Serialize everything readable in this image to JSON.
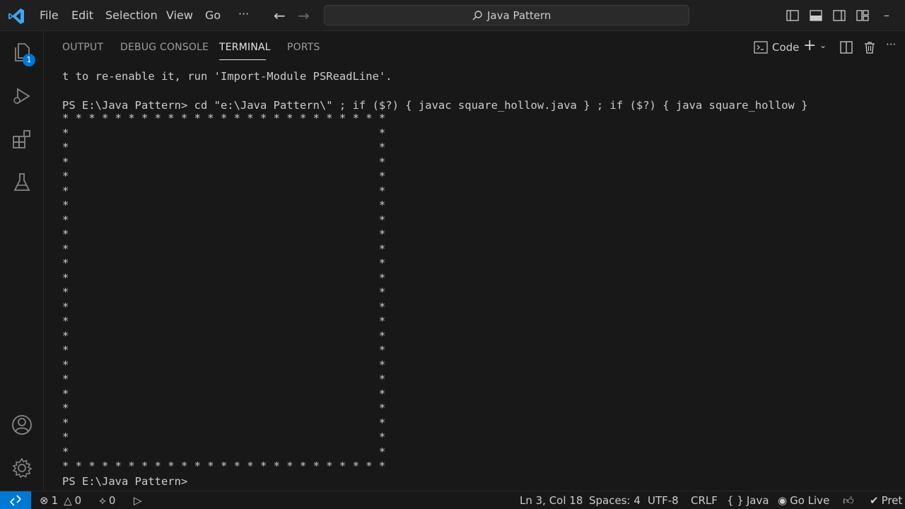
{
  "menu": [
    "File",
    "Edit",
    "Selection",
    "View",
    "Go",
    "···"
  ],
  "search": {
    "label": "Java Pattern"
  },
  "panel": {
    "tabs": [
      "OUTPUT",
      "DEBUG CONSOLE",
      "TERMINAL",
      "PORTS"
    ],
    "active_tab": "TERMINAL",
    "terminal_name": "Code"
  },
  "activity": {
    "explorer_badge": "1"
  },
  "terminal": {
    "lines": [
      "t to re-enable it, run 'Import-Module PSReadLine'.",
      "",
      "PS E:\\Java Pattern> cd \"e:\\Java Pattern\\\" ; if ($?) { javac square_hollow.java } ; if ($?) { java square_hollow }",
      "* * * * * * * * * * * * * * * * * * * * * * * * *",
      "*                                               *",
      "*                                               *",
      "*                                               *",
      "*                                               *",
      "*                                               *",
      "*                                               *",
      "*                                               *",
      "*                                               *",
      "*                                               *",
      "*                                               *",
      "*                                               *",
      "*                                               *",
      "*                                               *",
      "*                                               *",
      "*                                               *",
      "*                                               *",
      "*                                               *",
      "*                                               *",
      "*                                               *",
      "*                                               *",
      "*                                               *",
      "*                                               *",
      "*                                               *",
      "* * * * * * * * * * * * * * * * * * * * * * * * *",
      "PS E:\\Java Pattern>"
    ]
  },
  "status": {
    "errors": "1",
    "warnings": "0",
    "ports": "0",
    "position": "Ln 3, Col 18",
    "spaces": "Spaces: 4",
    "encoding": "UTF-8",
    "eol": "CRLF",
    "language": "Java",
    "go_live": "Go Live",
    "prettier": "Pret"
  },
  "colors": {
    "accent": "#0078d4",
    "background": "#181818",
    "text": "#cccccc"
  }
}
